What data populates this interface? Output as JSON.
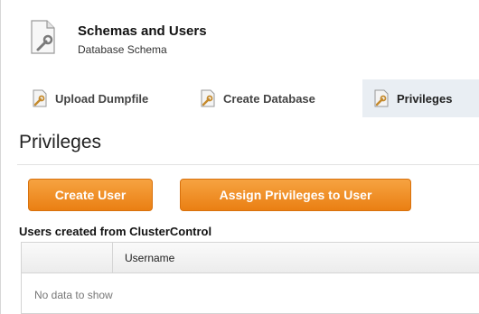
{
  "header": {
    "title": "Schemas and Users",
    "subtitle": "Database Schema",
    "icon": "document-wrench-icon"
  },
  "tabs": [
    {
      "label": "Upload Dumpfile",
      "icon": "document-wrench-icon",
      "active": false
    },
    {
      "label": "Create Database",
      "icon": "document-wrench-icon",
      "active": false
    },
    {
      "label": "Privileges",
      "icon": "document-wrench-icon",
      "active": true
    }
  ],
  "section": {
    "title": "Privileges"
  },
  "buttons": {
    "create_user": "Create User",
    "assign_privileges": "Assign Privileges to User"
  },
  "users": {
    "heading": "Users created from ClusterControl",
    "columns": [
      "",
      "Username"
    ],
    "empty_text": "No data to show"
  },
  "colors": {
    "accent": "#ea7f13",
    "active_tab_bg": "#e9eef3"
  }
}
